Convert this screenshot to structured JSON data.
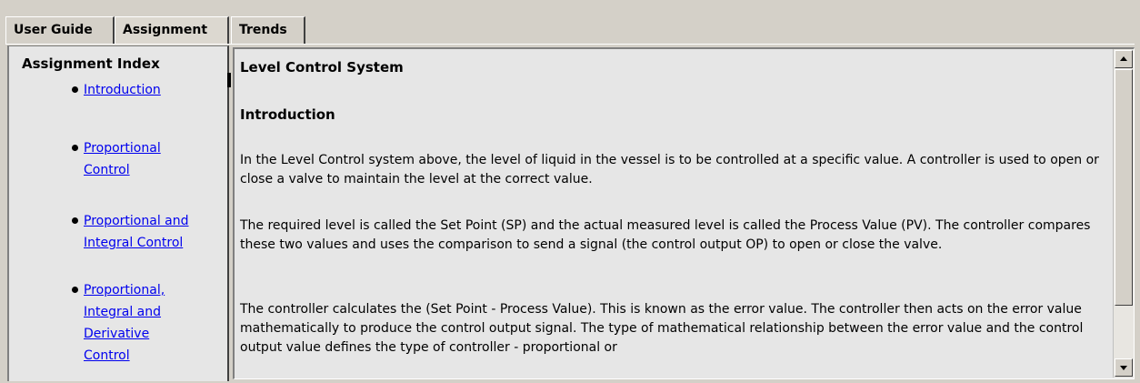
{
  "tabs": [
    {
      "label": "User Guide"
    },
    {
      "label": "Assignment"
    },
    {
      "label": "Trends"
    }
  ],
  "active_tab": "Assignment",
  "sidebar": {
    "title": "Assignment Index",
    "items": [
      {
        "label": "Introduction"
      },
      {
        "label": "Proportional\nControl"
      },
      {
        "label": "Proportional and\nIntegral Control"
      },
      {
        "label": "Proportional,\nIntegral and\nDerivative\nControl"
      }
    ]
  },
  "content": {
    "title": "Level Control System",
    "section_heading": "Introduction",
    "paragraphs": [
      "In the Level Control system above, the level of liquid in the vessel is to be controlled at a specific value. A controller is used to open or close a valve to maintain the level at the correct value.",
      "The required level is called the Set Point (SP) and the actual measured level is called the Process Value (PV). The controller compares these two values and uses the comparison to send a signal (the control output OP) to open or close the valve.",
      "The controller calculates the (Set Point - Process Value). This is known as the error value. The controller then acts on the error value mathematically to produce the control output signal. The type of mathematical relationship between the error value and the control output value defines the type of controller - proportional or"
    ]
  },
  "colors": {
    "link": "#0000ee",
    "panel_background": "#e6e6e6",
    "window_background": "#d4d0c8"
  }
}
